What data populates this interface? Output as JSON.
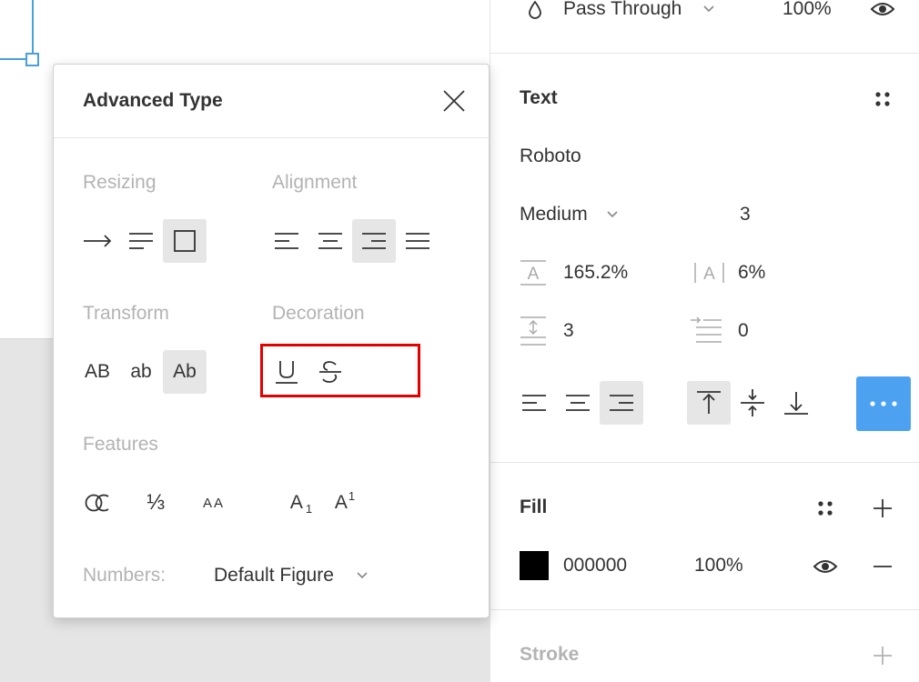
{
  "props": {
    "layer": {
      "blend_mode": "Pass Through",
      "opacity": "100%"
    },
    "text": {
      "title": "Text",
      "font_family": "Roboto",
      "font_weight": "Medium",
      "font_size": "3",
      "line_height": "165.2%",
      "letter_spacing": "6%",
      "paragraph_spacing": "3",
      "paragraph_indent": "0"
    },
    "fill": {
      "title": "Fill",
      "hex": "000000",
      "opacity": "100%",
      "swatch_color": "#000000"
    },
    "stroke": {
      "title": "Stroke"
    },
    "accent_color": "#4ca2f0"
  },
  "popup": {
    "title": "Advanced Type",
    "resizing_label": "Resizing",
    "alignment_label": "Alignment",
    "transform_label": "Transform",
    "decoration_label": "Decoration",
    "features_label": "Features",
    "transform_upper": "AB",
    "transform_lower": "ab",
    "transform_title": "Ab",
    "feature_fraction": "⅓",
    "feature_small_caps": "AA",
    "feature_subscript": "A",
    "feature_subscript_mark": "1",
    "feature_superscript": "A",
    "feature_superscript_mark": "1",
    "numbers_label": "Numbers:",
    "numbers_value": "Default Figure"
  }
}
